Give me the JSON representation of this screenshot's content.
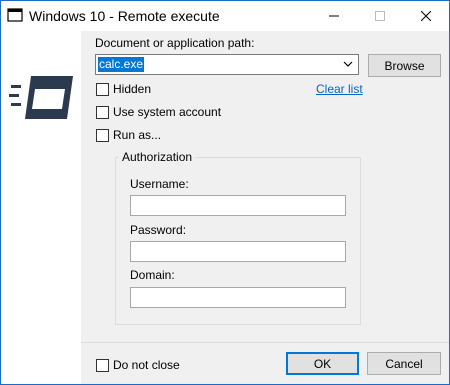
{
  "window": {
    "title": "Windows 10 - Remote execute"
  },
  "icons": {
    "app": "app-window-icon",
    "logo": "fast-window-logo",
    "minimize": "minimize-icon",
    "maximize": "maximize-icon",
    "close": "close-icon",
    "dropdown": "chevron-down-icon"
  },
  "form": {
    "path_label": "Document or application path:",
    "path_value": "calc.exe",
    "browse_label": "Browse",
    "hidden_label": "Hidden",
    "clear_list_label": "Clear list",
    "use_system_label": "Use system account",
    "run_as_label": "Run as...",
    "authorization": {
      "title": "Authorization",
      "username_label": "Username:",
      "username_value": "",
      "password_label": "Password:",
      "password_value": "",
      "domain_label": "Domain:",
      "domain_value": ""
    },
    "do_not_close_label": "Do not close",
    "ok_label": "OK",
    "cancel_label": "Cancel"
  },
  "colors": {
    "accent": "#0078d7",
    "logo": "#2b3a4f",
    "link": "#0066cc"
  }
}
